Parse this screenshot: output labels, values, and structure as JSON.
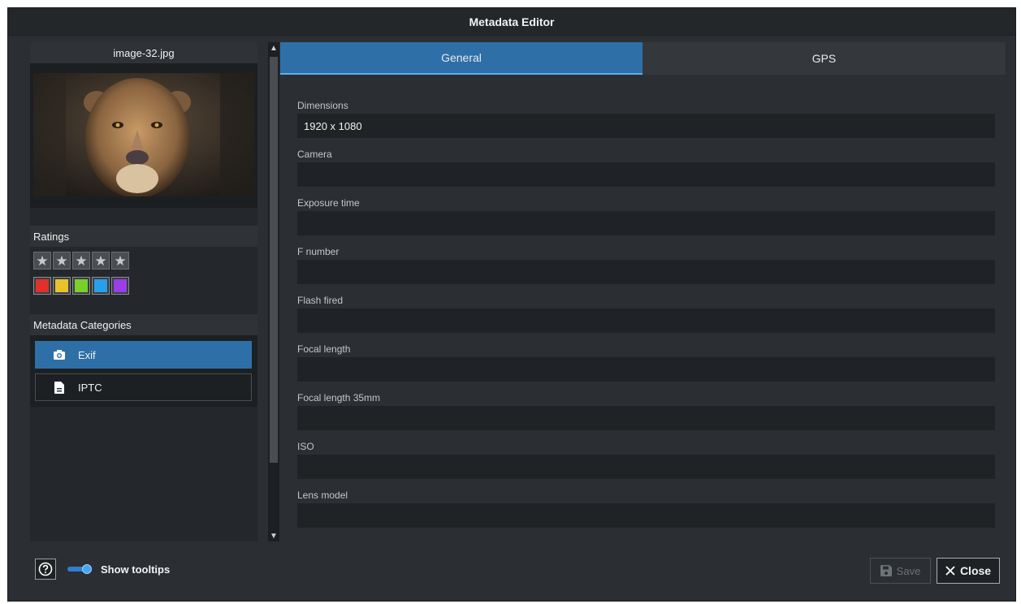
{
  "window": {
    "title": "Metadata Editor"
  },
  "left": {
    "file_name": "image-32.jpg",
    "ratings_header": "Ratings",
    "stars": [
      "star",
      "star",
      "star",
      "star",
      "star"
    ],
    "colors": [
      "#e0312a",
      "#e8c22a",
      "#7ccf2a",
      "#2a9fe8",
      "#9a3ee8"
    ],
    "categories_header": "Metadata Categories",
    "categories": [
      {
        "label": "Exif",
        "icon": "camera-icon"
      },
      {
        "label": "IPTC",
        "icon": "document-icon"
      }
    ]
  },
  "tabs": [
    "General",
    "GPS"
  ],
  "fields": [
    {
      "label": "Dimensions",
      "value": "1920 x 1080"
    },
    {
      "label": "Camera",
      "value": ""
    },
    {
      "label": "Exposure time",
      "value": ""
    },
    {
      "label": "F number",
      "value": ""
    },
    {
      "label": "Flash fired",
      "value": ""
    },
    {
      "label": "Focal length",
      "value": ""
    },
    {
      "label": "Focal length 35mm",
      "value": ""
    },
    {
      "label": "ISO",
      "value": ""
    },
    {
      "label": "Lens model",
      "value": ""
    }
  ],
  "footer": {
    "help_icon": "?",
    "show_tooltips_label": "Show tooltips",
    "show_tooltips_on": true,
    "save_label": "Save",
    "close_label": "Close"
  },
  "colors": {
    "accent": "#2f6fa8",
    "background": "#2b2f33"
  }
}
